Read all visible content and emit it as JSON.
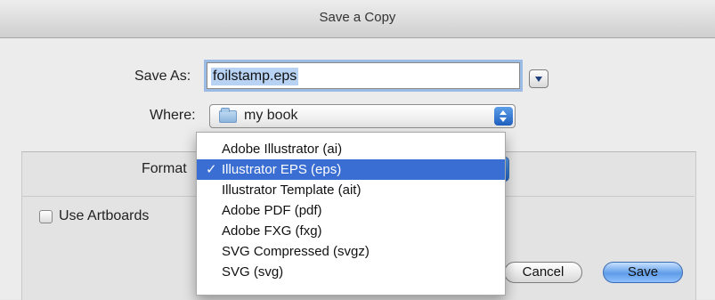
{
  "dialog": {
    "title": "Save a Copy",
    "save_as_label": "Save As:",
    "save_as_value": "foilstamp.eps",
    "where_label": "Where:",
    "where_value": "my book",
    "format_label": "Format",
    "use_artboards_label": "Use Artboards",
    "cancel_label": "Cancel",
    "save_label": "Save",
    "accent": "#3a6ed2"
  },
  "format_menu": {
    "items": [
      {
        "label": "Adobe Illustrator (ai)",
        "checked": ""
      },
      {
        "label": "Illustrator EPS (eps)",
        "checked": "✓"
      },
      {
        "label": "Illustrator Template (ait)",
        "checked": ""
      },
      {
        "label": "Adobe PDF (pdf)",
        "checked": ""
      },
      {
        "label": "Adobe FXG (fxg)",
        "checked": ""
      },
      {
        "label": "SVG Compressed (svgz)",
        "checked": ""
      },
      {
        "label": "SVG (svg)",
        "checked": ""
      }
    ],
    "selected_index": 1
  }
}
